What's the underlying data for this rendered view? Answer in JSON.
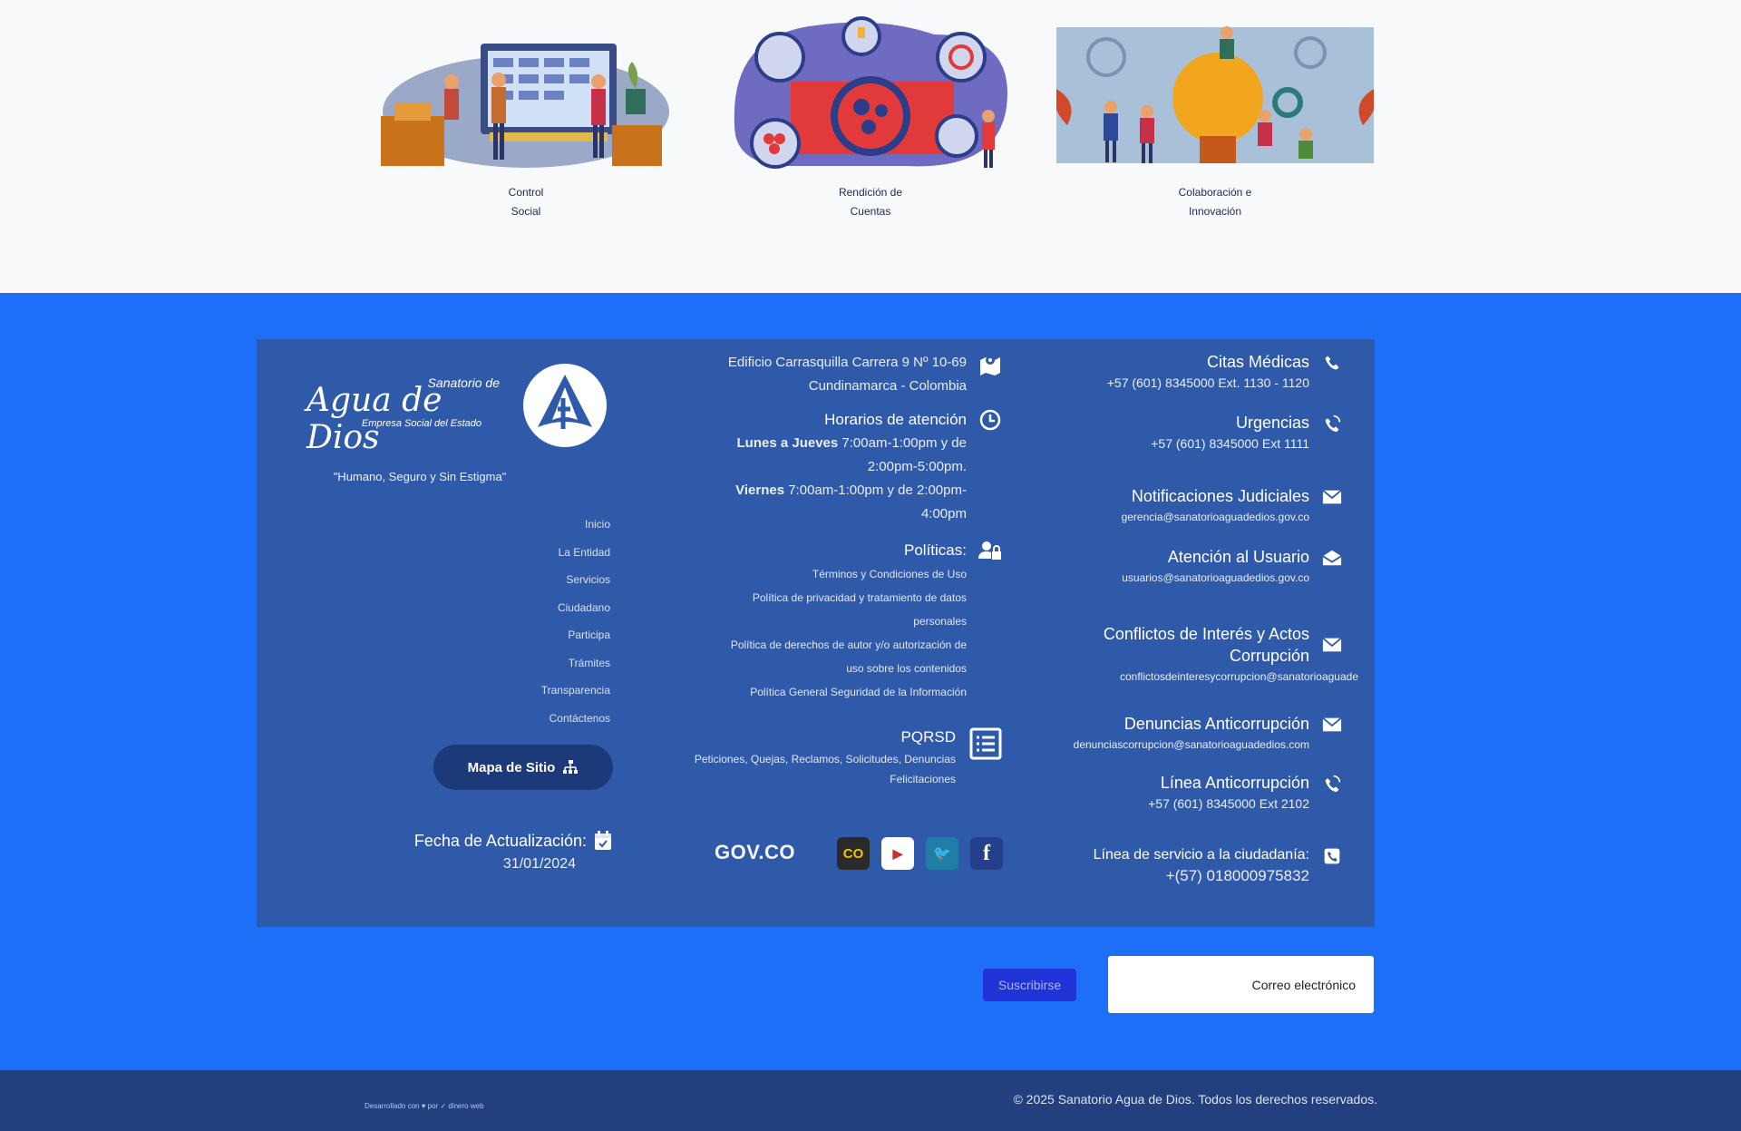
{
  "cards": [
    {
      "caption_lines": [
        "Control",
        "Social"
      ],
      "illustration": "control-social-illustration"
    },
    {
      "caption_lines": [
        "Rendición de",
        "Cuentas"
      ],
      "illustration": "rendicion-cuentas-illustration"
    },
    {
      "caption_lines": [
        "Colaboración e",
        "Innovación"
      ],
      "illustration": "colaboracion-innovacion-illustration"
    }
  ],
  "contacts": [
    {
      "title": "Citas Médicas",
      "lines": [
        "+57 (601) 8345000 Ext. 1130 - 1120"
      ],
      "icon": "phone-icon"
    },
    {
      "title": "Urgencias",
      "lines": [
        "+57 (601) 8345000 Ext 1111"
      ],
      "icon": "phone-ring-icon"
    },
    {
      "title": "Notificaciones Judiciales",
      "lines": [
        "gerencia@sanatorioaguadedios.gov.co"
      ],
      "icon": "mail-icon"
    },
    {
      "title": "Atención al Usuario",
      "lines": [
        "usuarios@sanatorioaguadedios.gov.co"
      ],
      "icon": "mail-open-icon"
    },
    {
      "title_lines": [
        "Conflictos de Interés y Actos",
        "Corrupción"
      ],
      "lines": [
        "conflictosdeinteresycorrupcion@sanatorioaguade"
      ],
      "icon": "mail-icon"
    },
    {
      "title": "Denuncias Anticorrupción",
      "lines": [
        "denunciascorrupcion@sanatorioaguadedios.com"
      ],
      "icon": "mail-icon"
    },
    {
      "title": "Línea Anticorrupción",
      "lines": [
        "+57 (601) 8345000 Ext 2102"
      ],
      "icon": "phone-ring-icon"
    },
    {
      "title": "Línea de servicio a la ciudadanía:",
      "lines": [
        "+(57) 018000975832"
      ],
      "icon": "phone-square-icon"
    }
  ],
  "address": {
    "lines": [
      "Edificio Carrasquilla Carrera 9 Nº 10-69",
      "Cundinamarca - Colombia"
    ]
  },
  "hours": {
    "title": "Horarios de atención",
    "lines": [
      {
        "bold": "Lunes a Jueves",
        "text": " 7:00am-1:00pm y de"
      },
      {
        "bold": "",
        "text": "2:00pm-5:00pm."
      },
      {
        "bold": "Viernes",
        "text": " 7:00am-1:00pm y de 2:00pm-"
      },
      {
        "bold": "",
        "text": "4:00pm"
      }
    ]
  },
  "policies": {
    "title": "Políticas:",
    "items": [
      "Términos y Condiciones de Uso",
      "Política de privacidad y tratamiento de datos",
      "personales",
      "Política de derechos de autor y/o autorización de",
      "uso sobre los contenidos",
      "Política General Seguridad de la Información"
    ]
  },
  "pqrsd": {
    "title": "PQRSD",
    "lines": [
      "Peticiones, Quejas, Reclamos, Solicitudes, Denuncias",
      "Felicitaciones"
    ]
  },
  "logo": {
    "top": "Sanatorio de",
    "main": "Agua de Dios",
    "sub": "Empresa Social del Estado"
  },
  "slogan": "\"Humano, Seguro y Sin Estigma\"",
  "nav_links": [
    "Inicio",
    "La Entidad",
    "Servicios",
    "Ciudadano",
    "Participa",
    "Trámites",
    "Transparencia",
    "Contáctenos"
  ],
  "sitemap_label": "Mapa de Sitio",
  "update": {
    "title": "Fecha de Actualización:",
    "date": "31/01/2024"
  },
  "social": [
    {
      "name": "facebook",
      "glyph": "f"
    },
    {
      "name": "twitter",
      "glyph": "🐦"
    },
    {
      "name": "youtube",
      "glyph": "▶"
    },
    {
      "name": "colombia",
      "glyph": "CO"
    }
  ],
  "govco": "GOV.CO",
  "subscribe": {
    "placeholder": "Correo electrónico",
    "button": "Suscribirse"
  },
  "footer": {
    "copyright": "© 2025 Sanatorio Agua de Dios. Todos los derechos reservados.",
    "developer": "Desarrollado con ♥ por ✓ dinero web"
  },
  "colors": {
    "page_bg": "#1e6ff7",
    "panel_bg": "#2f59a9",
    "bottom_bar": "#22407e",
    "subscribe_button": "#2033d6"
  }
}
